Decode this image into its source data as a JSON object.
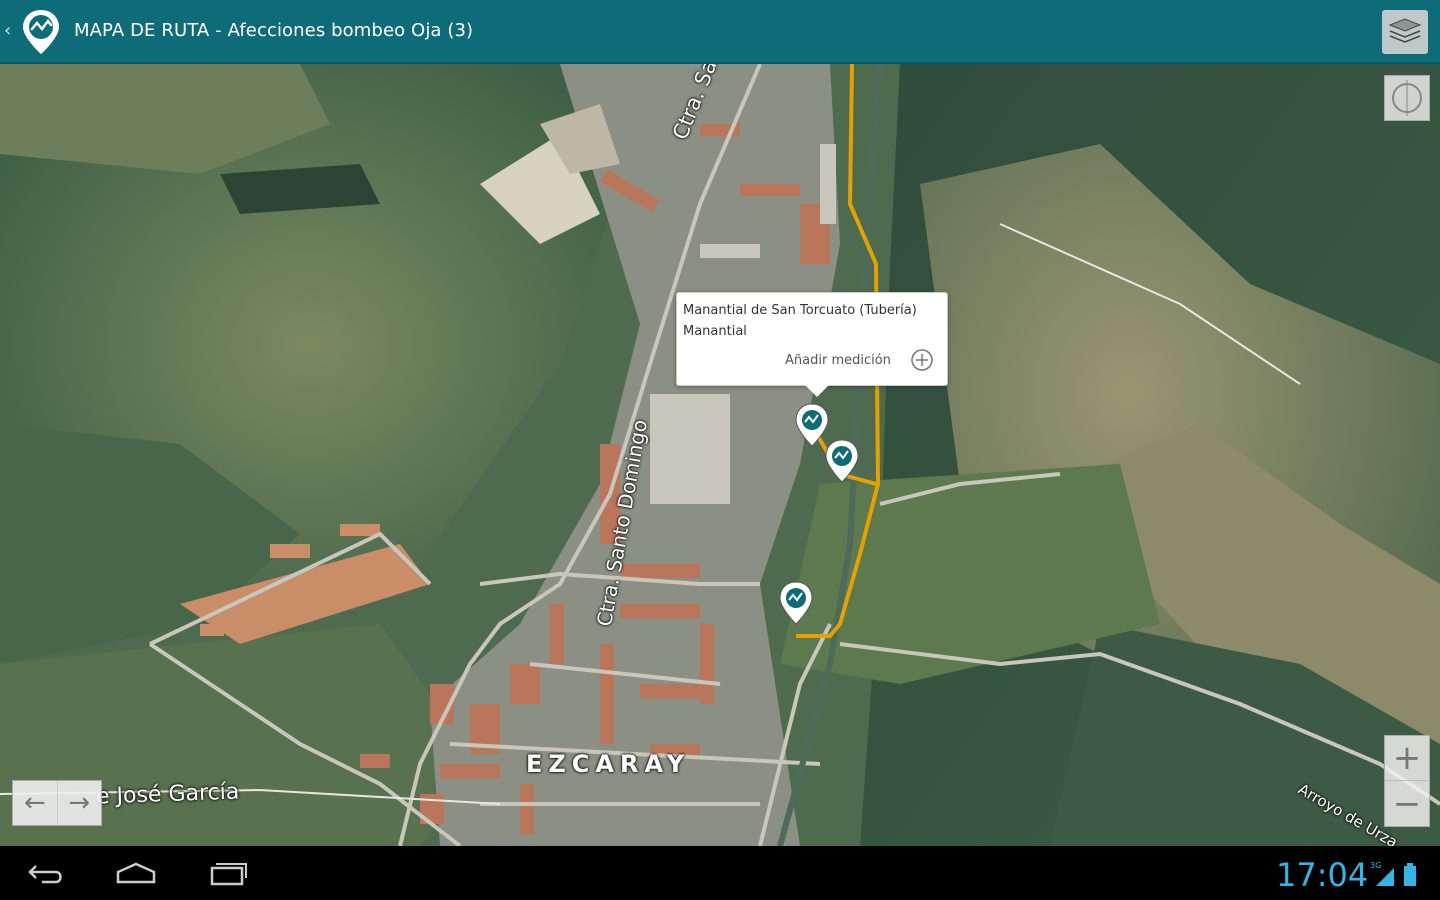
{
  "app": {
    "title": "MAPA DE RUTA - Afecciones bombeo Oja (3)",
    "accent_color": "#0e6b78",
    "icons": {
      "back": "chevron-left-icon",
      "app": "map-pin-route-icon",
      "layers": "layers-icon"
    }
  },
  "map": {
    "type": "satellite",
    "route_color": "#e6a000",
    "labels": {
      "road_north": "Ctra. Santo",
      "road_center": "Ctra. Santo Domingo",
      "road_south": "Ctra. Santo Domingo",
      "street": "e José García",
      "town": "EZCARAY",
      "stream": "Arroyo de Urza"
    },
    "markers": [
      {
        "name": "Manantial de San Torcuato (Tubería)",
        "type": "Manantial"
      },
      {
        "name": "",
        "type": ""
      },
      {
        "name": "",
        "type": ""
      }
    ],
    "popup": {
      "name": "Manantial de San Torcuato (Tubería)",
      "type": "Manantial",
      "action_label": "Añadir medición"
    },
    "controls": {
      "zoom_in": "+",
      "zoom_out": "−",
      "pan_left": "←",
      "pan_right": "→"
    }
  },
  "system_bar": {
    "time": "17:04",
    "signal": "3G",
    "icons": [
      "back-icon",
      "home-icon",
      "recents-icon",
      "signal-icon",
      "battery-icon"
    ]
  }
}
